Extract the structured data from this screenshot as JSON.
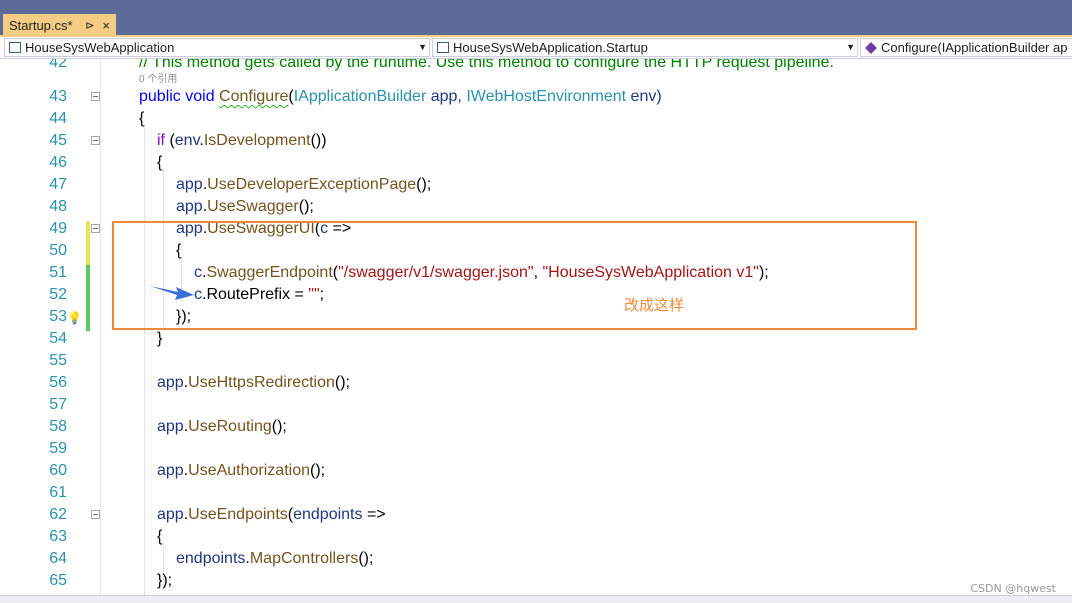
{
  "tab": {
    "label": "Startup.cs*",
    "pin": "⊳",
    "close": "×"
  },
  "navbar": {
    "project": "HouseSysWebApplication",
    "type": "HouseSysWebApplication.Startup",
    "member": "Configure(IApplicationBuilder ap"
  },
  "codelens": "0 个引用",
  "lines": [
    {
      "n": "42"
    },
    {
      "n": "43"
    },
    {
      "n": "44"
    },
    {
      "n": "45"
    },
    {
      "n": "46"
    },
    {
      "n": "47"
    },
    {
      "n": "48"
    },
    {
      "n": "49"
    },
    {
      "n": "50"
    },
    {
      "n": "51"
    },
    {
      "n": "52"
    },
    {
      "n": "53"
    },
    {
      "n": "54"
    },
    {
      "n": "55"
    },
    {
      "n": "56"
    },
    {
      "n": "57"
    },
    {
      "n": "58"
    },
    {
      "n": "59"
    },
    {
      "n": "60"
    },
    {
      "n": "61"
    },
    {
      "n": "62"
    },
    {
      "n": "63"
    },
    {
      "n": "64"
    },
    {
      "n": "65"
    }
  ],
  "code": {
    "l42": "// This method gets called by the runtime. Use this method to configure the HTTP request pipeline.",
    "l43_kw": "public void ",
    "l43_method": "Configure",
    "l43_p1": "(",
    "l43_t1": "IApplicationBuilder",
    "l43_v1": " app, ",
    "l43_t2": "IWebHostEnvironment",
    "l43_v2": " env)",
    "l44": "{",
    "l45_kw": "if",
    "l45_rest1": " (",
    "l45_var": "env",
    "l45_dot": ".",
    "l45_m": "IsDevelopment",
    "l45_rest2": "())",
    "l46": "{",
    "l47_var": "app",
    "l47_m": "UseDeveloperExceptionPage",
    "l47_rest": "();",
    "l48_var": "app",
    "l48_m": "UseSwagger",
    "l48_rest": "();",
    "l49_var": "app",
    "l49_m": "UseSwaggerUI",
    "l49_rest1": "(",
    "l49_c": "c",
    "l49_rest2": " =>",
    "l50": "{",
    "l51_var": "c",
    "l51_m": "SwaggerEndpoint",
    "l51_p1": "(",
    "l51_s1": "\"/swagger/v1/swagger.json\"",
    "l51_p2": ", ",
    "l51_s2": "\"HouseSysWebApplication v1\"",
    "l51_p3": ");",
    "l52_var": "c",
    "l52_rest": ".RoutePrefix = ",
    "l52_s": "\"\"",
    "l52_end": ";",
    "l53": "});",
    "l54": "}",
    "l56_var": "app",
    "l56_m": "UseHttpsRedirection",
    "l56_rest": "();",
    "l58_var": "app",
    "l58_m": "UseRouting",
    "l58_rest": "();",
    "l60_var": "app",
    "l60_m": "UseAuthorization",
    "l60_rest": "();",
    "l62_var": "app",
    "l62_m": "UseEndpoints",
    "l62_p": "(",
    "l62_v": "endpoints",
    "l62_rest": " =>",
    "l63": "{",
    "l64_var": "endpoints",
    "l64_m": "MapControllers",
    "l64_rest": "();",
    "l65": "});"
  },
  "annotation": "改成这样",
  "watermark": "CSDN @hqwest",
  "colors": {
    "tab_active": "#f5cc84",
    "title_bg": "#5d6b99",
    "annotation": "#ef8a3a",
    "arrow": "#3a6fd8"
  }
}
